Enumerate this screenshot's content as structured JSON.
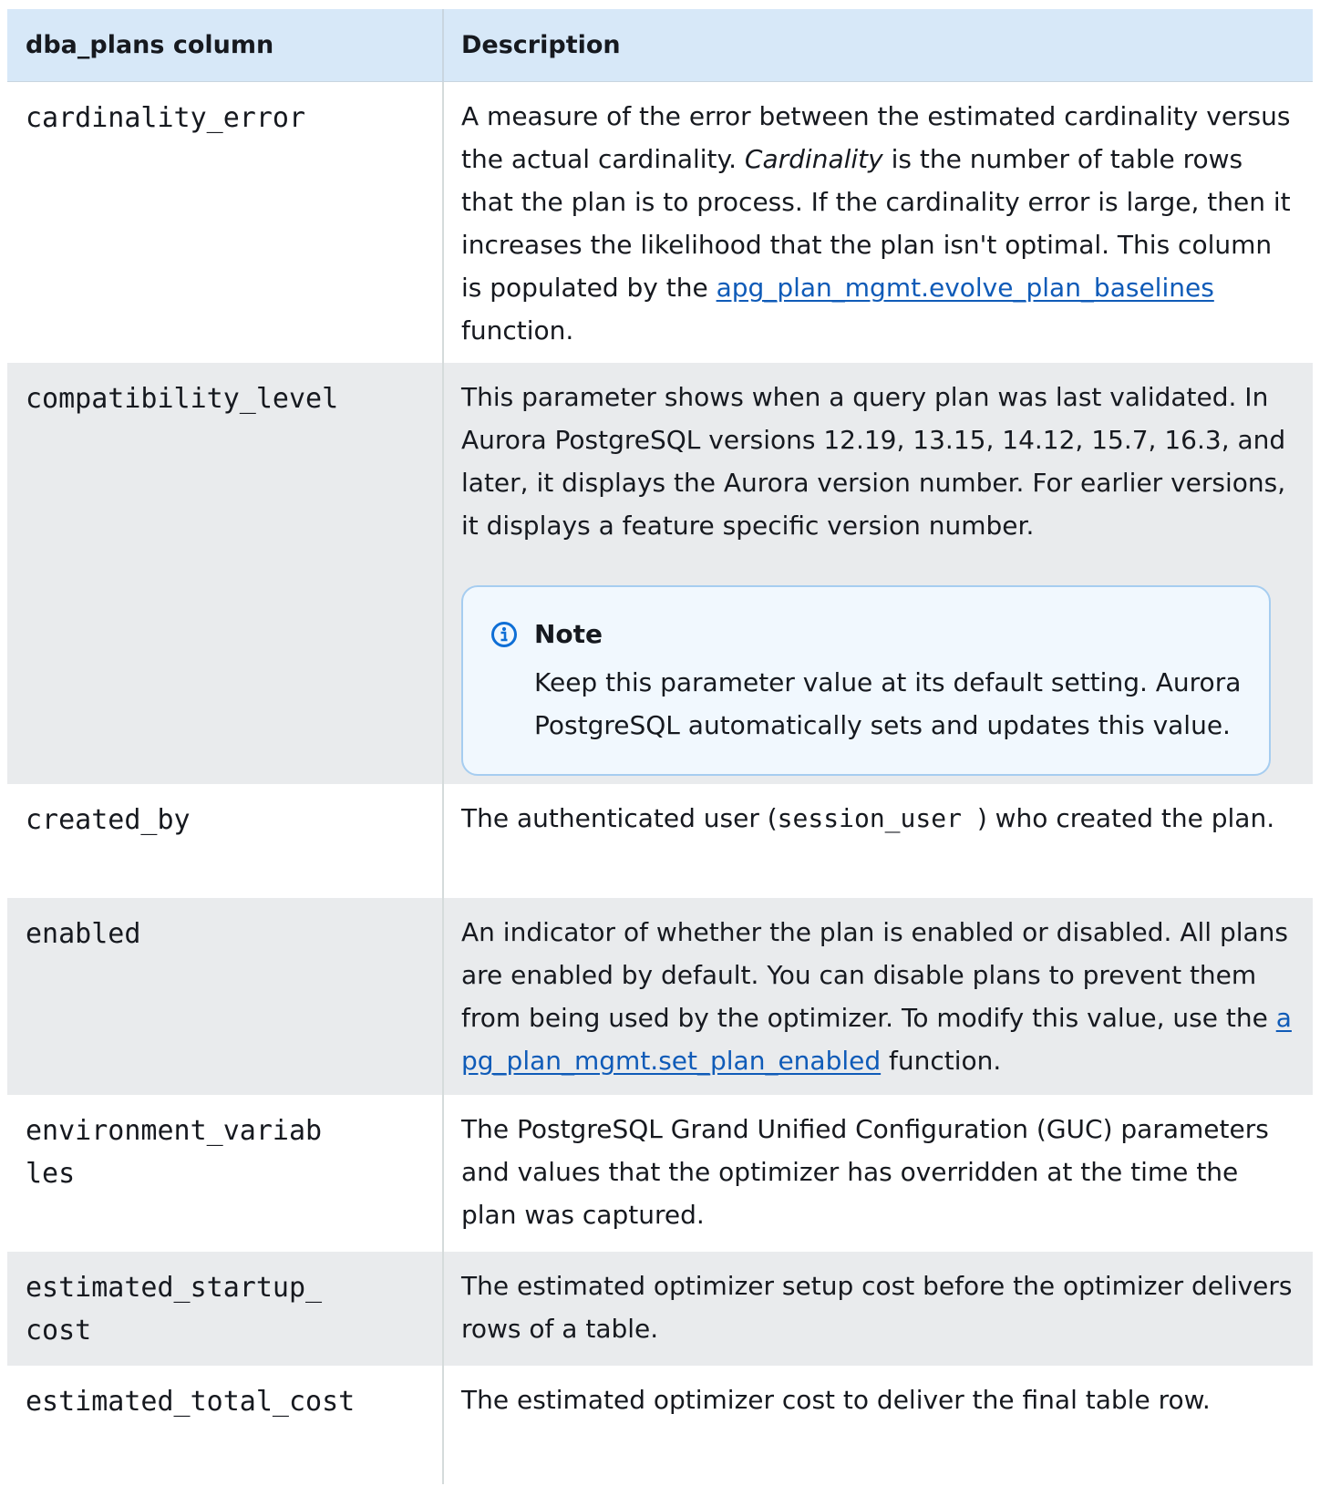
{
  "header": {
    "col1": "dba_plans column",
    "col2": "Description"
  },
  "rows": {
    "cardinality_error": {
      "name": "cardinality_error",
      "text_1": "A measure of the error between the estimated cardinality versus the actual cardinality. ",
      "em": "Cardinality",
      "text_2": " is the number of table rows that the plan is to process. If the cardinality error is large, then it increases the likelihood that the plan isn't optimal. This column is populated by the ",
      "link": "apg_plan_mgmt.evolve_plan_baselines",
      "text_3": " function."
    },
    "compatibility_level": {
      "name": "compatibility_level",
      "text": "This parameter shows when a query plan was last validated. In Aurora PostgreSQL versions 12.19, 13.15, 14.12, 15.7, 16.3, and later, it displays the Aurora version number. For earlier versions, it displays a feature specific version number.",
      "note_title": "Note",
      "note_text": "Keep this parameter value at its default setting. Aurora PostgreSQL automatically sets and updates this value."
    },
    "created_by": {
      "name": "created_by",
      "text_1": "The authenticated user (",
      "code": "session_user ",
      "text_2": ") who created the plan."
    },
    "enabled": {
      "name": "enabled",
      "text_1": "An indicator of whether the plan is enabled or disabled. All plans are enabled by default. You can disable plans to prevent them from being used by the optimizer. To modify this value, use the ",
      "link": "apg_plan_mgmt.set_plan_enabled",
      "text_2": " function."
    },
    "environment_variables": {
      "name": "environment_variables",
      "text": "The PostgreSQL Grand Unified Configuration (GUC) parameters and values that the optimizer has overridden at the time the plan was captured."
    },
    "estimated_startup_cost": {
      "name": "estimated_startup_cost",
      "text": "The estimated optimizer setup cost before the optimizer delivers rows of a table."
    },
    "estimated_total_cost": {
      "name": "estimated_total_cost",
      "text": "The estimated optimizer cost to deliver the final table row."
    }
  },
  "icons": {
    "note": "info-circle-icon"
  },
  "colors": {
    "header_bg": "#d7e8f8",
    "alt_row_bg": "#e9ebed",
    "link": "#0f5bb8",
    "note_bg": "#f1f8fe",
    "note_border": "#a6cdf0",
    "info_icon": "#0f6fd6"
  }
}
